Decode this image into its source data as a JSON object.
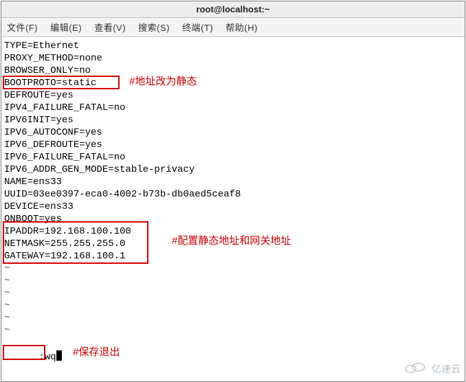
{
  "window": {
    "title": "root@localhost:~"
  },
  "menu": {
    "file": "文件(F)",
    "edit": "编辑(E)",
    "view": "查看(V)",
    "search": "搜索(S)",
    "terminal": "终端(T)",
    "help": "帮助(H)"
  },
  "config": {
    "lines": [
      "TYPE=Ethernet",
      "PROXY_METHOD=none",
      "BROWSER_ONLY=no",
      "BOOTPROTO=static",
      "DEFROUTE=yes",
      "IPV4_FAILURE_FATAL=no",
      "IPV6INIT=yes",
      "IPV6_AUTOCONF=yes",
      "IPV6_DEFROUTE=yes",
      "IPV6_FAILURE_FATAL=no",
      "IPV6_ADDR_GEN_MODE=stable-privacy",
      "NAME=ens33",
      "UUID=03ee0397-eca0-4002-b73b-db0aed5ceaf8",
      "DEVICE=ens33",
      "ONBOOT=yes",
      "IPADDR=192.168.100.100",
      "NETMASK=255.255.255.0",
      "GATEWAY=192.168.100.1"
    ],
    "tilde": "~"
  },
  "vim": {
    "command": ":wq"
  },
  "annotations": {
    "static_addr": "#地址改为静态",
    "ip_config": "#配置静态地址和网关地址",
    "save_exit": "#保存退出"
  },
  "watermark": {
    "text": "亿速云"
  }
}
